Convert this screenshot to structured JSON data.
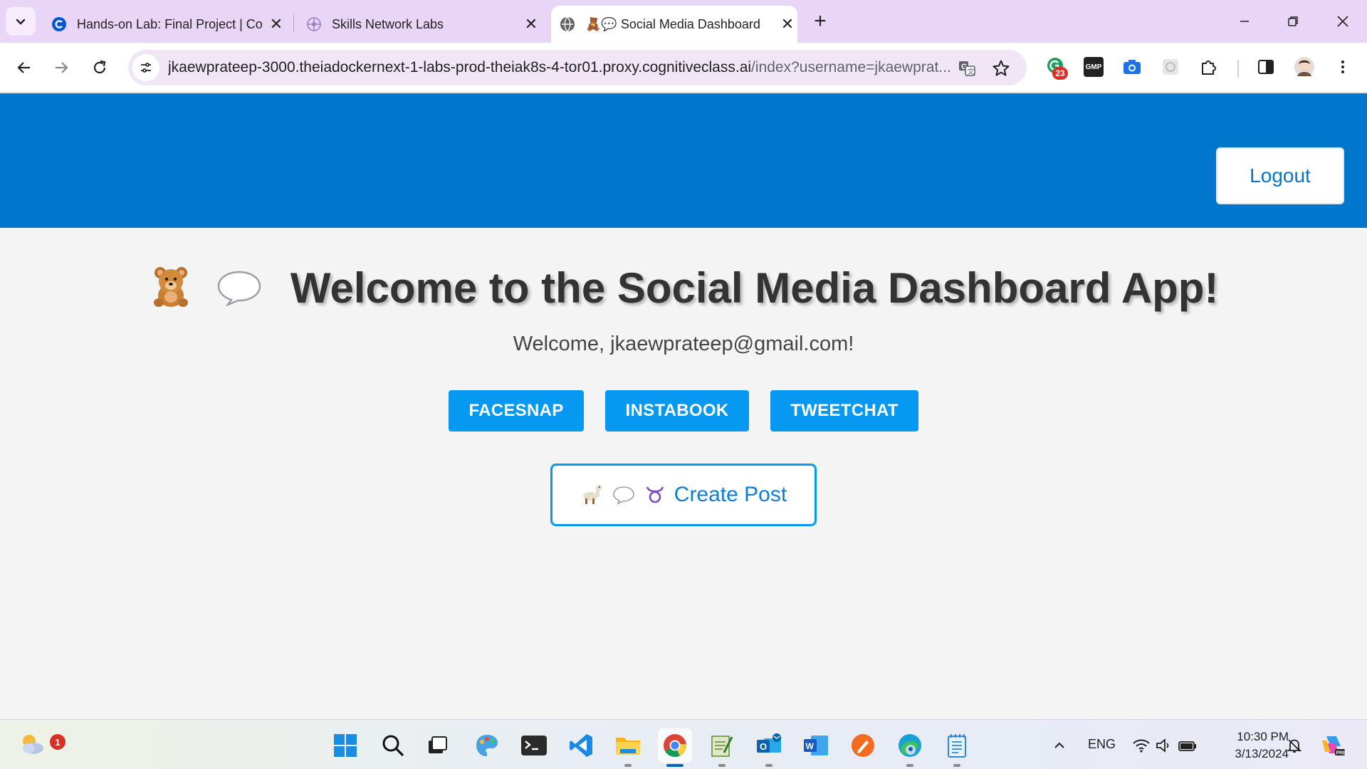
{
  "browser": {
    "tabs": [
      {
        "title": "Hands-on Lab: Final Project | Co",
        "favicon": "coursera-icon",
        "active": false
      },
      {
        "title": "Skills Network Labs",
        "favicon": "skills-network-icon",
        "active": false
      },
      {
        "title": "🧸💬 Social Media Dashboard",
        "favicon": "globe-icon",
        "active": true
      }
    ],
    "address": {
      "host": "jkaewprateep-3000.theiadockernext-1-labs-prod-theiak8s-4-tor01.proxy.cognitiveclass.ai",
      "path": "/index?username=jkaewprat..."
    },
    "extensions": {
      "badge_count": "23",
      "gmp_label": "GMP"
    }
  },
  "page": {
    "logout_label": "Logout",
    "title_text": "Welcome to the Social Media Dashboard App!",
    "welcome_text": "Welcome, jkaewprateep@gmail.com!",
    "social_buttons": [
      {
        "label": "FACESNAP"
      },
      {
        "label": "INSTABOOK"
      },
      {
        "label": "TWEETCHAT"
      }
    ],
    "create_post_label": "Create Post",
    "colors": {
      "header": "#0077cc",
      "button": "#0799f2",
      "title": "#333333"
    }
  },
  "taskbar": {
    "weather_badge": "1",
    "language": "ENG",
    "time": "10:30 PM",
    "date": "3/13/2024",
    "apps": [
      "start-icon",
      "search-icon",
      "task-view-icon",
      "paint-icon",
      "terminal-icon",
      "vscode-icon",
      "file-explorer-icon",
      "chrome-icon",
      "notepad-plus-icon",
      "outlook-icon",
      "word-icon",
      "pen-app-icon",
      "edge-icon",
      "notepad-icon"
    ]
  }
}
